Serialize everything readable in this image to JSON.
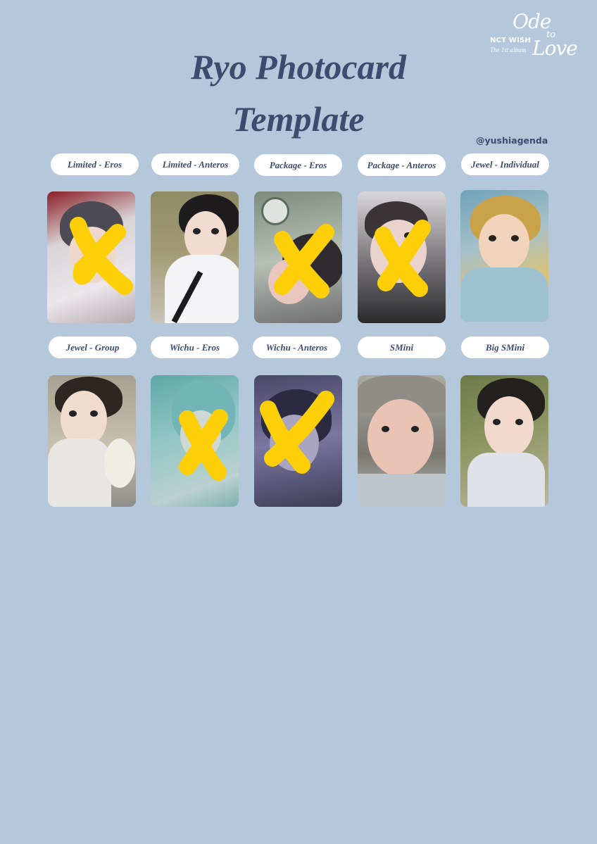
{
  "title_line1": "Ryo Photocard",
  "title_line2": "Template",
  "handle": "@yushiagenda",
  "logo": {
    "brand": "NCT WISH",
    "subtitle": "The 1st album",
    "word_ode": "Ode",
    "word_to": "to",
    "word_love": "Love"
  },
  "cards": [
    {
      "label": "Limited - Eros",
      "crossed": true
    },
    {
      "label": "Limited - Anteros",
      "crossed": false
    },
    {
      "label": "Package - Eros",
      "crossed": true
    },
    {
      "label": "Package - Anteros",
      "crossed": true
    },
    {
      "label": "Jewel - Individual",
      "crossed": false
    },
    {
      "label": "Jewel - Group",
      "crossed": false
    },
    {
      "label": "Wichu - Eros",
      "crossed": true
    },
    {
      "label": "Wichu - Anteros",
      "crossed": true
    },
    {
      "label": "SMini",
      "crossed": false
    },
    {
      "label": "Big SMini",
      "crossed": false
    }
  ],
  "colors": {
    "background": "#b4c7db",
    "text": "#3b4d6e",
    "pill": "#ffffff",
    "cross_mark": "#fccf08"
  }
}
